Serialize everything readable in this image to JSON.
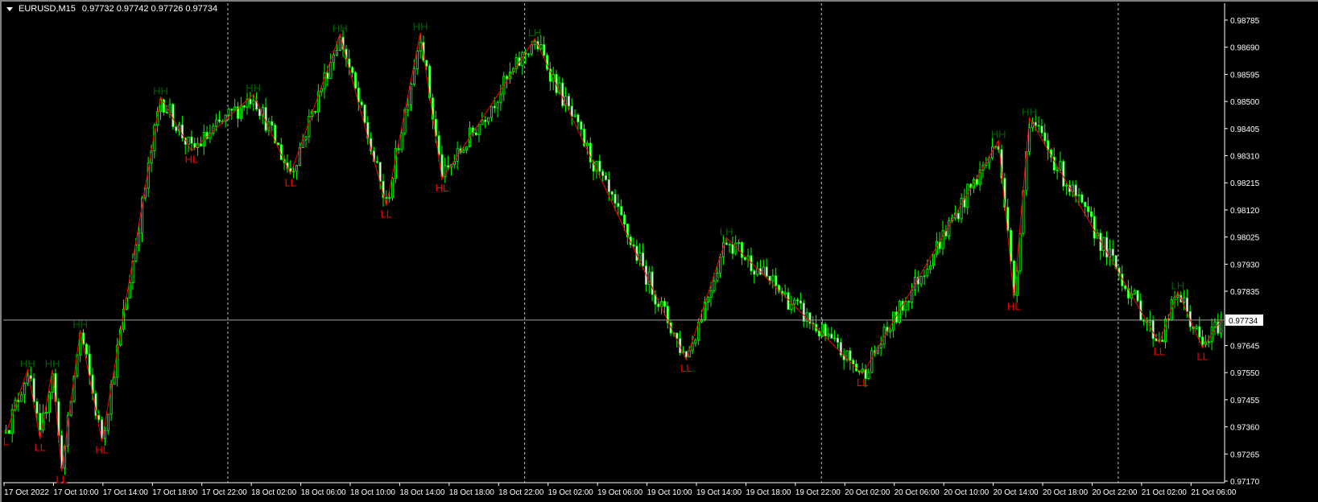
{
  "header": {
    "symbol": "EURUSD,M15",
    "ohlc": "0.97732 0.97742 0.97726 0.97734"
  },
  "colors": {
    "background": "#000000",
    "candle": "#00ff00",
    "bear_body": "#ffffff",
    "zigzag": "#ff0000",
    "high_label": "#006400",
    "low_label": "#ff0000",
    "axis_text": "#ffffff",
    "price_line": "#a0a0a0"
  },
  "chart_data": {
    "type": "candlestick",
    "title": "EURUSD,M15",
    "timeframe_minutes": 15,
    "bars": 394,
    "ylim": [
      0.9717,
      0.98785
    ],
    "current_price": "0.97734",
    "y_ticks": [
      "0.98785",
      "0.98690",
      "0.98595",
      "0.98500",
      "0.98405",
      "0.98310",
      "0.98215",
      "0.98120",
      "0.98025",
      "0.97930",
      "0.97835",
      "0.97734",
      "0.97645",
      "0.97550",
      "0.97455",
      "0.97360",
      "0.97265",
      "0.97170"
    ],
    "x_ticks": [
      "17 Oct 2022",
      "17 Oct 10:00",
      "17 Oct 14:00",
      "17 Oct 18:00",
      "17 Oct 22:00",
      "18 Oct 02:00",
      "18 Oct 06:00",
      "18 Oct 10:00",
      "18 Oct 14:00",
      "18 Oct 18:00",
      "18 Oct 22:00",
      "19 Oct 02:00",
      "19 Oct 06:00",
      "19 Oct 10:00",
      "19 Oct 14:00",
      "19 Oct 18:00",
      "19 Oct 22:00",
      "20 Oct 02:00",
      "20 Oct 06:00",
      "20 Oct 10:00",
      "20 Oct 14:00",
      "20 Oct 18:00",
      "20 Oct 22:00",
      "21 Oct 02:00",
      "21 Oct 06:00"
    ],
    "day_separators_bar": [
      72,
      168,
      264,
      360
    ],
    "zigzag": [
      {
        "bar": 0,
        "price": 0.97338,
        "label": "L"
      },
      {
        "bar": 7,
        "price": 0.9756,
        "label": "HH"
      },
      {
        "bar": 11,
        "price": 0.97318,
        "label": "LL"
      },
      {
        "bar": 15,
        "price": 0.9756,
        "label": "HH"
      },
      {
        "bar": 18,
        "price": 0.97205,
        "label": "LL"
      },
      {
        "bar": 24,
        "price": 0.97699,
        "label": "HH"
      },
      {
        "bar": 31,
        "price": 0.97309,
        "label": "HL"
      },
      {
        "bar": 50,
        "price": 0.98516,
        "label": "HH"
      },
      {
        "bar": 60,
        "price": 0.98327,
        "label": "HL"
      },
      {
        "bar": 80,
        "price": 0.98525,
        "label": "HH"
      },
      {
        "bar": 92,
        "price": 0.98245,
        "label": "LL"
      },
      {
        "bar": 108,
        "price": 0.98735,
        "label": "HH"
      },
      {
        "bar": 123,
        "price": 0.98135,
        "label": "LL"
      },
      {
        "bar": 134,
        "price": 0.98741,
        "label": "HH"
      },
      {
        "bar": 141,
        "price": 0.98227,
        "label": "HL"
      },
      {
        "bar": 171,
        "price": 0.9872,
        "label": "LH"
      },
      {
        "bar": 220,
        "price": 0.97595,
        "label": "LL"
      },
      {
        "bar": 233,
        "price": 0.98023,
        "label": "LH"
      },
      {
        "bar": 277,
        "price": 0.97545,
        "label": "LL"
      },
      {
        "bar": 321,
        "price": 0.98363,
        "label": "HH"
      },
      {
        "bar": 326,
        "price": 0.97811,
        "label": "HL"
      },
      {
        "bar": 331,
        "price": 0.98443,
        "label": "HH"
      },
      {
        "bar": 373,
        "price": 0.97654,
        "label": "LL"
      },
      {
        "bar": 379,
        "price": 0.97834,
        "label": "LH"
      },
      {
        "bar": 387,
        "price": 0.97637,
        "label": "LL"
      },
      {
        "bar": 393,
        "price": 0.97734,
        "label": ""
      }
    ]
  }
}
